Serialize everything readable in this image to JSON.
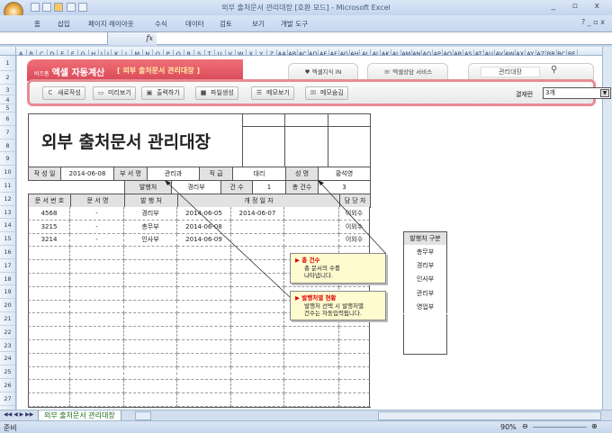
{
  "window": {
    "title": "외부 출처문서 관리대장  [호환 모드] - Microsoft Excel",
    "controls": "_ ▫ x"
  },
  "ribbon": {
    "tabs": [
      "홈",
      "삽입",
      "페이지 레이아웃",
      "수식",
      "데이터",
      "검토",
      "보기",
      "개발 도구"
    ]
  },
  "formula": {
    "fx": "fx",
    "value": ""
  },
  "columns": [
    "A",
    "B",
    "C",
    "D",
    "E",
    "F",
    "G",
    "H",
    "I",
    "J",
    "K",
    "L",
    "M",
    "N",
    "O",
    "P",
    "Q",
    "R",
    "S",
    "T",
    "U",
    "V",
    "W",
    "X",
    "Y",
    "Z",
    "AA",
    "AB",
    "AC",
    "AD",
    "AE",
    "AF",
    "AG",
    "AH",
    "AI",
    "AJ",
    "AK",
    "AL",
    "AM",
    "AN",
    "AO",
    "AP",
    "AQ",
    "AR",
    "AS",
    "AT",
    "AU",
    "AV",
    "AW",
    "AX",
    "AY",
    "AZ",
    "BB",
    "BC",
    "BE"
  ],
  "rows": [
    "1",
    "2",
    "3",
    "4",
    "5",
    "6",
    "7",
    "8",
    "9",
    "10",
    "11",
    "12",
    "13",
    "14",
    "15",
    "16",
    "17",
    "18",
    "19",
    "20",
    "21",
    "22",
    "23",
    "24",
    "25",
    "26",
    "27",
    "28"
  ],
  "banner": {
    "brand_small": "비즈폼",
    "brand": "엑셀 자동계산",
    "subtitle": "[ 외부 출처문서 관리대장 ]",
    "tab1": "♥ 엑셀지식 IN",
    "tab2": "☏ 엑셀상담 서비스",
    "search": "관리대장"
  },
  "toolbar": {
    "buttons": [
      {
        "icon": "C",
        "label": "새로작성"
      },
      {
        "icon": "▭",
        "label": "미리보기"
      },
      {
        "icon": "▣",
        "label": "출력하기"
      },
      {
        "icon": "■",
        "label": "파일생성"
      },
      {
        "icon": "☰",
        "label": "메모보기"
      },
      {
        "icon": "☒",
        "label": "메모숨김"
      }
    ],
    "count_label": "결재란",
    "count_value": "3개"
  },
  "doc": {
    "title": "외부 출처문서 관리대장",
    "info": {
      "date_label": "작 성 일",
      "date": "2014-06-08",
      "dept_label": "부 서 명",
      "dept": "관리과",
      "rank_label": "직  급",
      "rank": "대리",
      "name_label": "성  명",
      "name": "황석영"
    },
    "filter": {
      "issuer_label": "발행처",
      "issuer": "경리부",
      "count_label": "건  수",
      "count": "1",
      "total_label": "총 건수",
      "total": "3"
    },
    "headers": [
      "문 서 번 호",
      "문   서   명",
      "발 행 처",
      "개     정     일     자",
      "담 당 자"
    ],
    "records": [
      {
        "no": "4568",
        "name": "-",
        "issuer": "경리부",
        "d1": "2014-06-05",
        "d2": "2014-06-07",
        "d3": "",
        "owner": "이외수"
      },
      {
        "no": "3215",
        "name": "-",
        "issuer": "총무부",
        "d1": "2014-06-08",
        "d2": "",
        "d3": "",
        "owner": "이외수"
      },
      {
        "no": "3214",
        "name": "-",
        "issuer": "인사부",
        "d1": "2014-06-09",
        "d2": "",
        "d3": "",
        "owner": "이외수"
      }
    ]
  },
  "side": {
    "header": "발행처 구분",
    "items": [
      "총무부",
      "경리부",
      "인사부",
      "관리부",
      "영업부"
    ]
  },
  "callouts": [
    {
      "title": "▶ 총 건수",
      "body": "총 문서의 수를\n나타냅니다."
    },
    {
      "title": "▶ 발행처별 현황",
      "body": "발행처 선택 시 발행처별\n건수는 자동입력됩니다."
    }
  ],
  "sheet_tab": "외부 출처문서 관리대장",
  "status": {
    "ready": "준비",
    "zoom": "90%"
  }
}
